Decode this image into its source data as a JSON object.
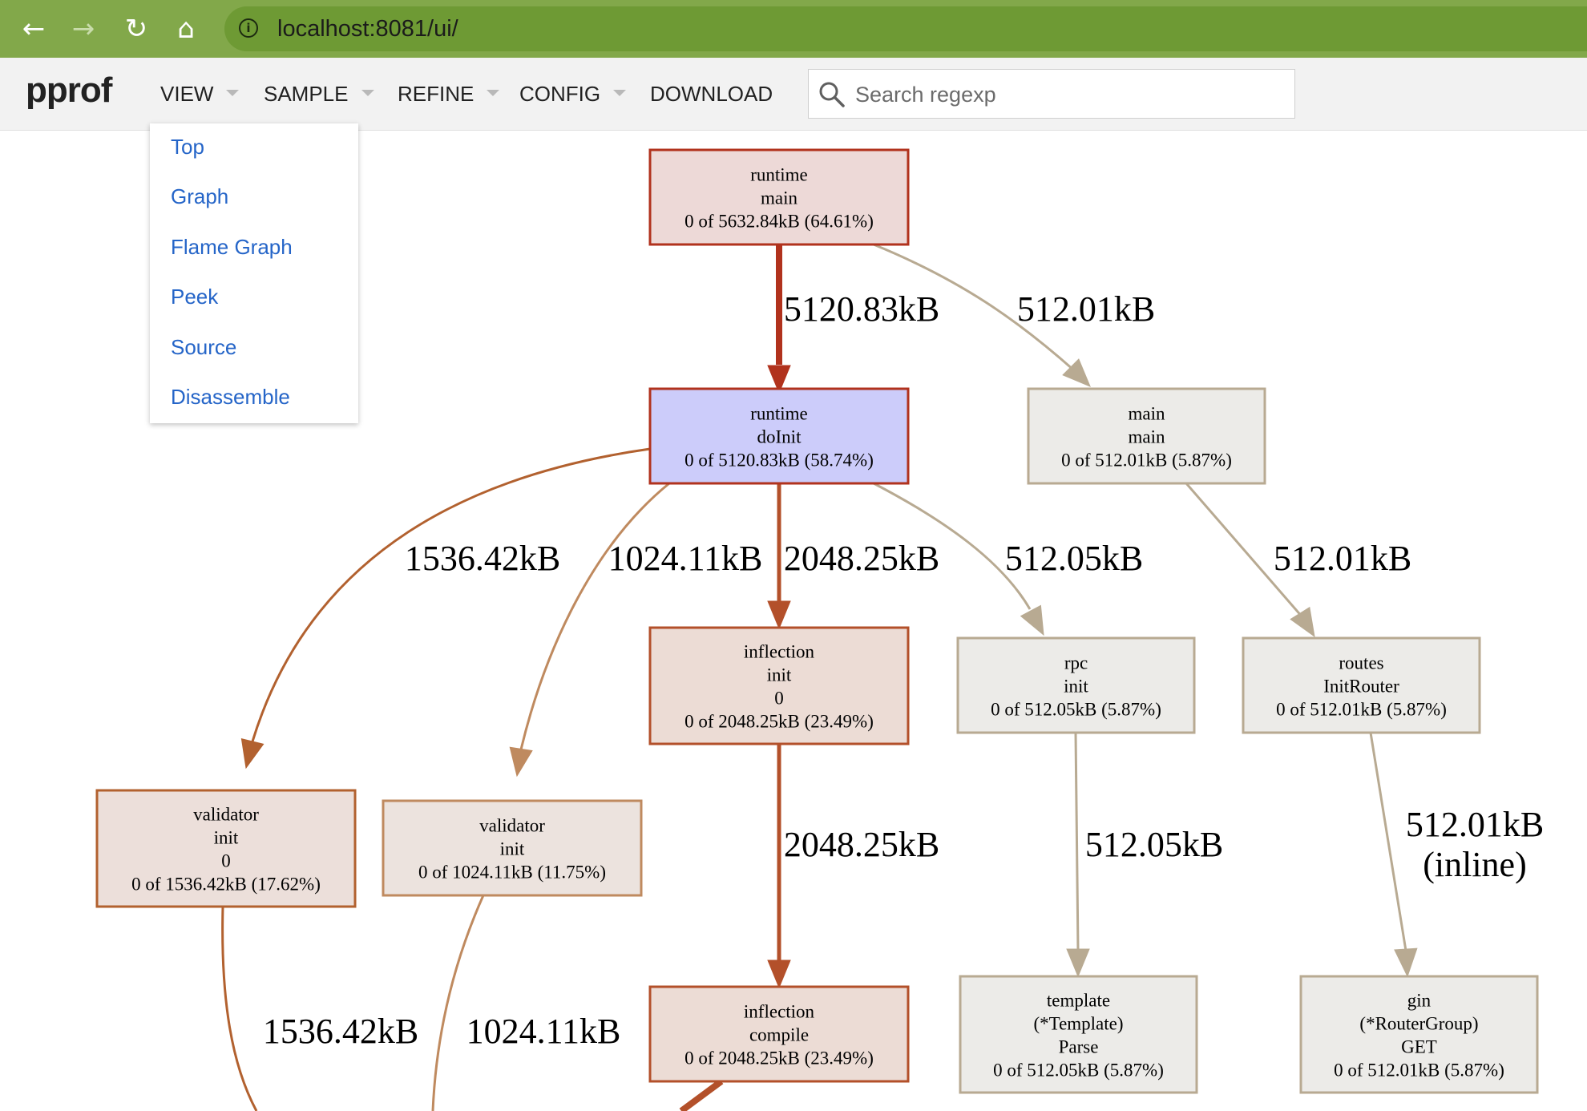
{
  "browser": {
    "url": "localhost:8081/ui/",
    "back_icon": "←",
    "forward_icon": "→",
    "reload_icon": "↻",
    "home_icon": "⌂",
    "info_icon": "i"
  },
  "toolbar": {
    "brand": "pprof",
    "menus": [
      "VIEW",
      "SAMPLE",
      "REFINE",
      "CONFIG",
      "DOWNLOAD"
    ],
    "search_placeholder": "Search regexp"
  },
  "view_menu": {
    "items": [
      "Top",
      "Graph",
      "Flame Graph",
      "Peek",
      "Source",
      "Disassemble"
    ]
  },
  "graph": {
    "nodes": [
      {
        "id": "runtime-main",
        "lines": [
          "runtime",
          "main",
          "0 of 5632.84kB (64.61%)"
        ],
        "fill": "#edd9d7",
        "stroke": "#b1321d"
      },
      {
        "id": "runtime-doinit",
        "lines": [
          "runtime",
          "doInit",
          "0 of 5120.83kB (58.74%)"
        ],
        "fill": "#ccccfa",
        "stroke": "#b1321d"
      },
      {
        "id": "main-main",
        "lines": [
          "main",
          "main",
          "0 of 512.01kB (5.87%)"
        ],
        "fill": "#ecebe8",
        "stroke": "#b8aa92"
      },
      {
        "id": "inflection-init",
        "lines": [
          "inflection",
          "init",
          "0",
          "0 of 2048.25kB (23.49%)"
        ],
        "fill": "#ecdcd5",
        "stroke": "#b3502a"
      },
      {
        "id": "rpc-init",
        "lines": [
          "rpc",
          "init",
          "0 of 512.05kB (5.87%)"
        ],
        "fill": "#ecebe8",
        "stroke": "#b8aa92"
      },
      {
        "id": "routes-initrouter",
        "lines": [
          "routes",
          "InitRouter",
          "0 of 512.01kB (5.87%)"
        ],
        "fill": "#ecebe8",
        "stroke": "#b8aa92"
      },
      {
        "id": "validator-init-1536",
        "lines": [
          "validator",
          "init",
          "0",
          "0 of 1536.42kB (17.62%)"
        ],
        "fill": "#ecdfda",
        "stroke": "#b2612f"
      },
      {
        "id": "validator-init-1024",
        "lines": [
          "validator",
          "init",
          "0 of 1024.11kB (11.75%)"
        ],
        "fill": "#ece3de",
        "stroke": "#bf8a5f"
      },
      {
        "id": "inflection-compile",
        "lines": [
          "inflection",
          "compile",
          "0 of 2048.25kB (23.49%)"
        ],
        "fill": "#ecdcd5",
        "stroke": "#b3502a"
      },
      {
        "id": "template-parse",
        "lines": [
          "template",
          "(*Template)",
          "Parse",
          "0 of 512.05kB (5.87%)"
        ],
        "fill": "#ecebe8",
        "stroke": "#b8aa92"
      },
      {
        "id": "gin-get",
        "lines": [
          "gin",
          "(*RouterGroup)",
          "GET",
          "0 of 512.01kB (5.87%)"
        ],
        "fill": "#ecebe8",
        "stroke": "#b8aa92"
      }
    ],
    "edges": [
      {
        "from": "runtime-main",
        "to": "runtime-doinit",
        "label": [
          "5120.83kB"
        ],
        "color": "#b1321d"
      },
      {
        "from": "runtime-main",
        "to": "main-main",
        "label": [
          "512.01kB"
        ],
        "color": "#b8aa92"
      },
      {
        "from": "runtime-doinit",
        "to": "validator-init-1536",
        "label": [
          "1536.42kB"
        ],
        "color": "#b2612f"
      },
      {
        "from": "runtime-doinit",
        "to": "validator-init-1024",
        "label": [
          "1024.11kB"
        ],
        "color": "#bf8a5f"
      },
      {
        "from": "runtime-doinit",
        "to": "inflection-init",
        "label": [
          "2048.25kB"
        ],
        "color": "#b3502a"
      },
      {
        "from": "runtime-doinit",
        "to": "rpc-init",
        "label": [
          "512.05kB"
        ],
        "color": "#b8aa92"
      },
      {
        "from": "main-main",
        "to": "routes-initrouter",
        "label": [
          "512.01kB"
        ],
        "color": "#b8aa92"
      },
      {
        "from": "inflection-init",
        "to": "inflection-compile",
        "label": [
          "2048.25kB"
        ],
        "color": "#b3502a"
      },
      {
        "from": "rpc-init",
        "to": "template-parse",
        "label": [
          "512.05kB"
        ],
        "color": "#b8aa92"
      },
      {
        "from": "routes-initrouter",
        "to": "gin-get",
        "label": [
          "512.01kB",
          "(inline)"
        ],
        "color": "#b8aa92"
      },
      {
        "from": "validator-init-1536",
        "to": "offscreen-a",
        "label": [
          "1536.42kB"
        ],
        "color": "#b2612f"
      },
      {
        "from": "validator-init-1024",
        "to": "offscreen-b",
        "label": [
          "1024.11kB"
        ],
        "color": "#bf8a5f"
      },
      {
        "from": "inflection-compile",
        "to": "offscreen-c",
        "label": [],
        "color": "#b3502a"
      }
    ]
  }
}
